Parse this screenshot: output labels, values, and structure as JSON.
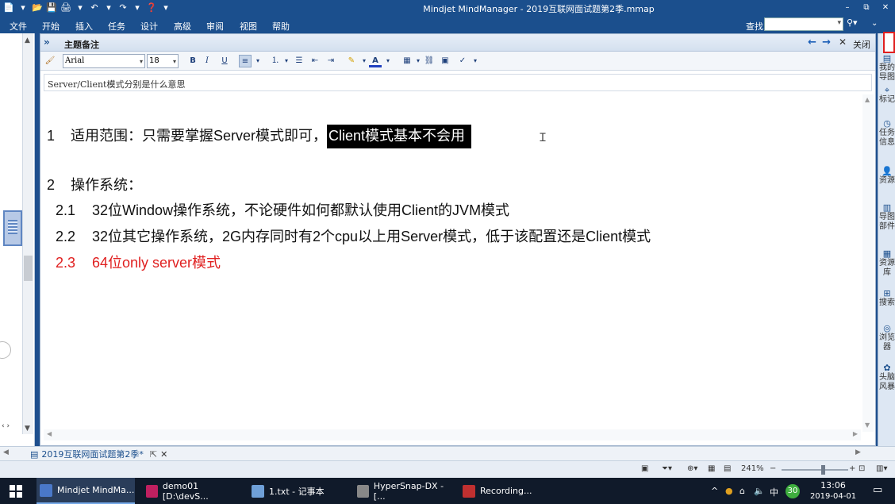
{
  "window": {
    "title": "Mindjet MindManager - 2019互联网面试题第2季.mmap",
    "controls": [
      "–",
      "⧉",
      "✕"
    ]
  },
  "quick_access": [
    "📄",
    "▾",
    "📂",
    "💾",
    "🖨",
    "▾",
    "↶",
    "▾",
    "↷",
    "▾",
    "❓",
    "▾"
  ],
  "menu": [
    "文件",
    "开始",
    "插入",
    "任务",
    "设计",
    "高级",
    "审阅",
    "视图",
    "帮助"
  ],
  "search": {
    "label": "查找:",
    "value": ""
  },
  "notes_panel": {
    "title": "主题备注",
    "close_label": "关闭",
    "font": "Arial",
    "size": "18",
    "topic_text": "Server/Client模式分别是什么意思"
  },
  "note_lines": [
    {
      "num": "1",
      "text_before": "适用范围：只需要掌握Server模式即可，",
      "highlight": "Client模式基本不会用"
    },
    {
      "num": "2",
      "text": "操作系统："
    },
    {
      "num": "2.1",
      "text": "32位Window操作系统，不论硬件如何都默认使用Client的JVM模式"
    },
    {
      "num": "2.2",
      "text": "32位其它操作系统，2G内存同时有2个cpu以上用Server模式，低于该配置还是Client模式"
    },
    {
      "num": "2.3",
      "text": "64位only server模式",
      "color": "#e02020"
    }
  ],
  "right_tabs": [
    {
      "icon": "▤",
      "label": "我的导图"
    },
    {
      "icon": "⌖",
      "label": "标记"
    },
    {
      "icon": "◷",
      "label": "任务信息"
    },
    {
      "icon": "👤",
      "label": "资源"
    },
    {
      "icon": "▥",
      "label": "导图部件"
    },
    {
      "icon": "▦",
      "label": "资源库"
    },
    {
      "icon": "⊞",
      "label": "搜索"
    },
    {
      "icon": "◎",
      "label": "浏览器"
    },
    {
      "icon": "✿",
      "label": "头脑风暴"
    }
  ],
  "doc_tab": {
    "label": "2019互联网面试题第2季*"
  },
  "status": {
    "zoom": "241%"
  },
  "taskbar": {
    "apps": [
      {
        "label": "Mindjet MindMa...",
        "color": "#4a78c8"
      },
      {
        "label": "demo01 [D:\\devS...",
        "color": "#c02060"
      },
      {
        "label": "1.txt - 记事本",
        "color": "#6fa0d8"
      },
      {
        "label": "HyperSnap-DX - [...",
        "color": "#888888"
      },
      {
        "label": "Recording...",
        "color": "#c03030"
      }
    ],
    "ime": "中",
    "ime_badge": "30",
    "time": "13:06",
    "date": "2019-04-01"
  }
}
